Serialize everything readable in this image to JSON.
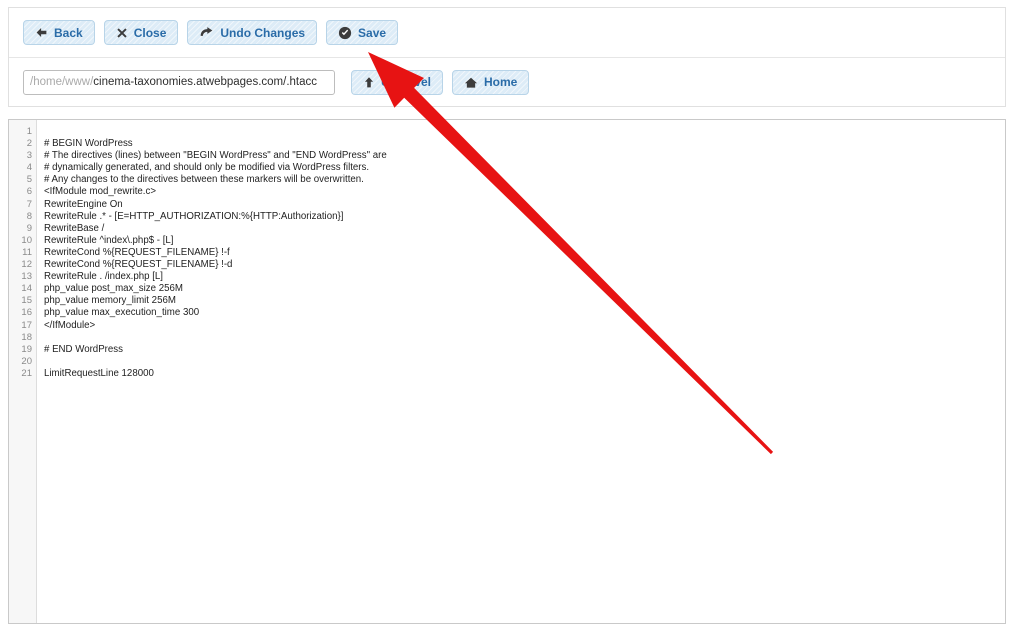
{
  "toolbar": {
    "buttons": [
      {
        "label": "Back",
        "icon": "arrow-left-icon"
      },
      {
        "label": "Close",
        "icon": "close-x-icon"
      },
      {
        "label": "Undo Changes",
        "icon": "undo-arrow-icon"
      },
      {
        "label": "Save",
        "icon": "check-circle-icon"
      }
    ]
  },
  "path_bar": {
    "path_prefix": "/home/www/",
    "path_value": "cinema-taxonomies.atwebpages.com/.htacc",
    "full_path": "/home/www/cinema-taxonomies.atwebpages.com/.htacc",
    "buttons": [
      {
        "label": "Up Level",
        "icon": "arrow-up-icon"
      },
      {
        "label": "Home",
        "icon": "home-icon"
      }
    ]
  },
  "editor": {
    "line_numbers": [
      1,
      2,
      3,
      4,
      5,
      6,
      7,
      8,
      9,
      10,
      11,
      12,
      13,
      14,
      15,
      16,
      17,
      18,
      19,
      20,
      21
    ],
    "lines": [
      "",
      "# BEGIN WordPress",
      "# The directives (lines) between \"BEGIN WordPress\" and \"END WordPress\" are",
      "# dynamically generated, and should only be modified via WordPress filters.",
      "# Any changes to the directives between these markers will be overwritten.",
      "<IfModule mod_rewrite.c>",
      "RewriteEngine On",
      "RewriteRule .* - [E=HTTP_AUTHORIZATION:%{HTTP:Authorization}]",
      "RewriteBase /",
      "RewriteRule ^index\\.php$ - [L]",
      "RewriteCond %{REQUEST_FILENAME} !-f",
      "RewriteCond %{REQUEST_FILENAME} !-d",
      "RewriteRule . /index.php [L]",
      "php_value post_max_size 256M",
      "php_value memory_limit 256M",
      "php_value max_execution_time 300",
      "</IfModule>",
      "",
      "# END WordPress",
      "",
      "LimitRequestLine 128000"
    ]
  },
  "annotation": {
    "arrow_color": "#e71313",
    "points_to": "Save"
  }
}
